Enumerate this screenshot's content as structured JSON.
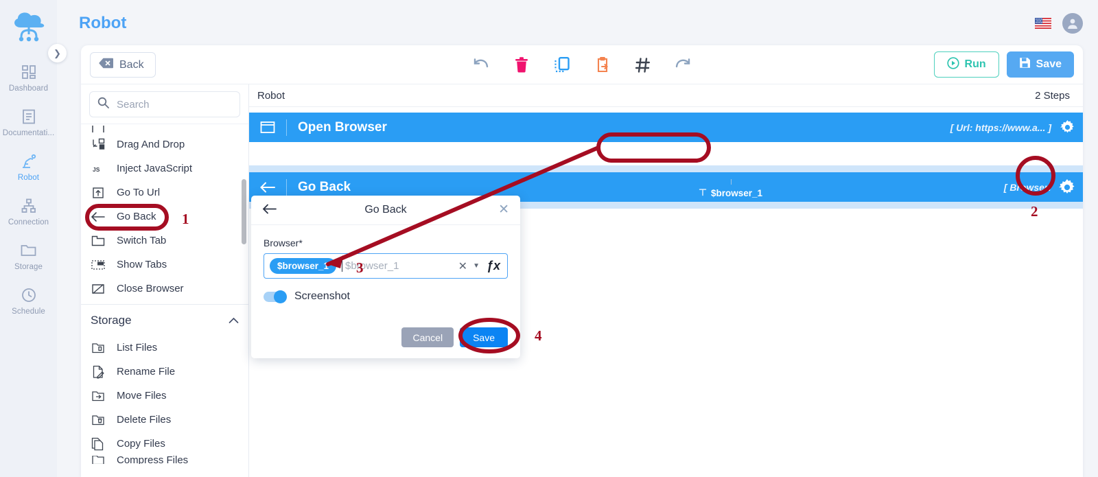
{
  "header": {
    "title": "Robot",
    "flag_icon": "us-flag-icon",
    "avatar_icon": "user-avatar-icon"
  },
  "left_rail": {
    "logo_icon": "cloud-robot-logo",
    "collapse_icon": "chevron-right-icon",
    "items": [
      {
        "label": "Dashboard",
        "icon": "dashboard-grid-icon",
        "active": false
      },
      {
        "label": "Documentati...",
        "icon": "document-icon",
        "active": false
      },
      {
        "label": "Robot",
        "icon": "robot-arm-icon",
        "active": true
      },
      {
        "label": "Connection",
        "icon": "sitemap-icon",
        "active": false
      },
      {
        "label": "Storage",
        "icon": "folder-icon",
        "active": false
      },
      {
        "label": "Schedule",
        "icon": "clock-icon",
        "active": false
      }
    ]
  },
  "toolbar": {
    "back_label": "Back",
    "back_icon": "backspace-icon",
    "icons": [
      {
        "name": "undo-icon",
        "color": "#8ca3bf"
      },
      {
        "name": "delete-icon",
        "color": "#f0136e"
      },
      {
        "name": "copy-icon",
        "color": "#2a9df4"
      },
      {
        "name": "paste-icon",
        "color": "#f4834f"
      },
      {
        "name": "hash-icon",
        "color": "#3d4450"
      },
      {
        "name": "redo-icon",
        "color": "#8ca3bf"
      }
    ],
    "run_label": "Run",
    "run_icon": "play-circle-icon",
    "run_color": "#2ec4b0",
    "save_label": "Save",
    "save_icon": "floppy-disk-icon",
    "save_color": "#56a9f2"
  },
  "action_panel": {
    "search_placeholder": "Search",
    "search_value": "",
    "search_icon": "search-icon",
    "items": [
      {
        "label": "Drag And Drop",
        "icon": "drag-drop-icon",
        "highlighted": false
      },
      {
        "label": "Inject JavaScript",
        "icon": "js-icon",
        "highlighted": false
      },
      {
        "label": "Go To Url",
        "icon": "upload-box-icon",
        "highlighted": false
      },
      {
        "label": "Go Back",
        "icon": "arrow-left-icon",
        "highlighted": true
      },
      {
        "label": "Switch Tab",
        "icon": "tab-icon",
        "highlighted": false
      },
      {
        "label": "Show Tabs",
        "icon": "tabs-dashed-icon",
        "highlighted": false
      },
      {
        "label": "Close Browser",
        "icon": "close-browser-icon",
        "highlighted": false
      }
    ],
    "group": {
      "label": "Storage",
      "chevron_icon": "chevron-up-icon"
    },
    "storage_items": [
      {
        "label": "List Files",
        "icon": "list-files-icon"
      },
      {
        "label": "Rename File",
        "icon": "rename-file-icon"
      },
      {
        "label": "Move Files",
        "icon": "move-files-icon"
      },
      {
        "label": "Delete Files",
        "icon": "delete-files-icon"
      },
      {
        "label": "Copy Files",
        "icon": "copy-files-icon"
      },
      {
        "label": "Compress Files",
        "icon": "compress-files-icon"
      }
    ]
  },
  "canvas": {
    "robot_label": "Robot",
    "steps_count": "2 Steps",
    "steps": [
      {
        "name": "Open Browser",
        "icon": "browser-window-icon",
        "params": "[ Url: https://www.a... ]",
        "gear_icon": "gear-icon"
      },
      {
        "name": "Go Back",
        "icon": "arrow-left-icon",
        "params": "[ Browser:",
        "gear_icon": "gear-icon"
      }
    ],
    "variable_chip": {
      "label": "$browser_1",
      "type_icon": "text-type-icon"
    }
  },
  "modal": {
    "title": "Go Back",
    "back_icon": "arrow-left-icon",
    "close_icon": "close-icon",
    "field_label": "Browser*",
    "chip_value": "$browser_1",
    "field_placeholder": "$browser_1",
    "clear_icon": "clear-x-icon",
    "dropdown_icon": "chevron-down-icon",
    "fx_icon": "fx-icon",
    "fx_label": "ƒx",
    "toggle_label": "Screenshot",
    "toggle_on": true,
    "cancel_label": "Cancel",
    "save_label": "Save"
  },
  "annotations": {
    "color": "#a50d22",
    "markers": [
      {
        "number": "1",
        "target": "go-back-action-item"
      },
      {
        "number": "2",
        "target": "go-back-step-gear"
      },
      {
        "number": "3",
        "target": "browser-field"
      },
      {
        "number": "4",
        "target": "modal-save-button"
      }
    ]
  }
}
